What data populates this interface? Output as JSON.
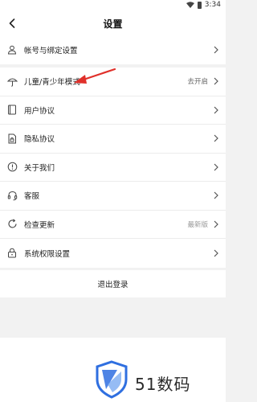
{
  "status_bar": {
    "time": "3:34"
  },
  "header": {
    "title": "设置"
  },
  "account_group": [
    {
      "label": "帐号与绑定设置",
      "icon": "user-icon"
    }
  ],
  "settings_group": [
    {
      "label": "儿童/青少年模式",
      "value": "去开启",
      "icon": "umbrella-icon"
    },
    {
      "label": "用户协议",
      "value": "",
      "icon": "book-icon"
    },
    {
      "label": "隐私协议",
      "value": "",
      "icon": "privacy-lock-doc-icon"
    },
    {
      "label": "关于我们",
      "value": "",
      "icon": "info-icon"
    },
    {
      "label": "客服",
      "value": "",
      "icon": "headset-icon"
    },
    {
      "label": "检查更新",
      "value": "最新版",
      "icon": "refresh-icon"
    },
    {
      "label": "系统权限设置",
      "value": "",
      "icon": "lock-icon"
    }
  ],
  "logout": {
    "label": "退出登录"
  },
  "watermark": {
    "text": "51数码"
  },
  "colors": {
    "background": "#f2f2f2",
    "annotation_arrow": "#e0302a",
    "watermark_blue": "#2f6fe0"
  }
}
